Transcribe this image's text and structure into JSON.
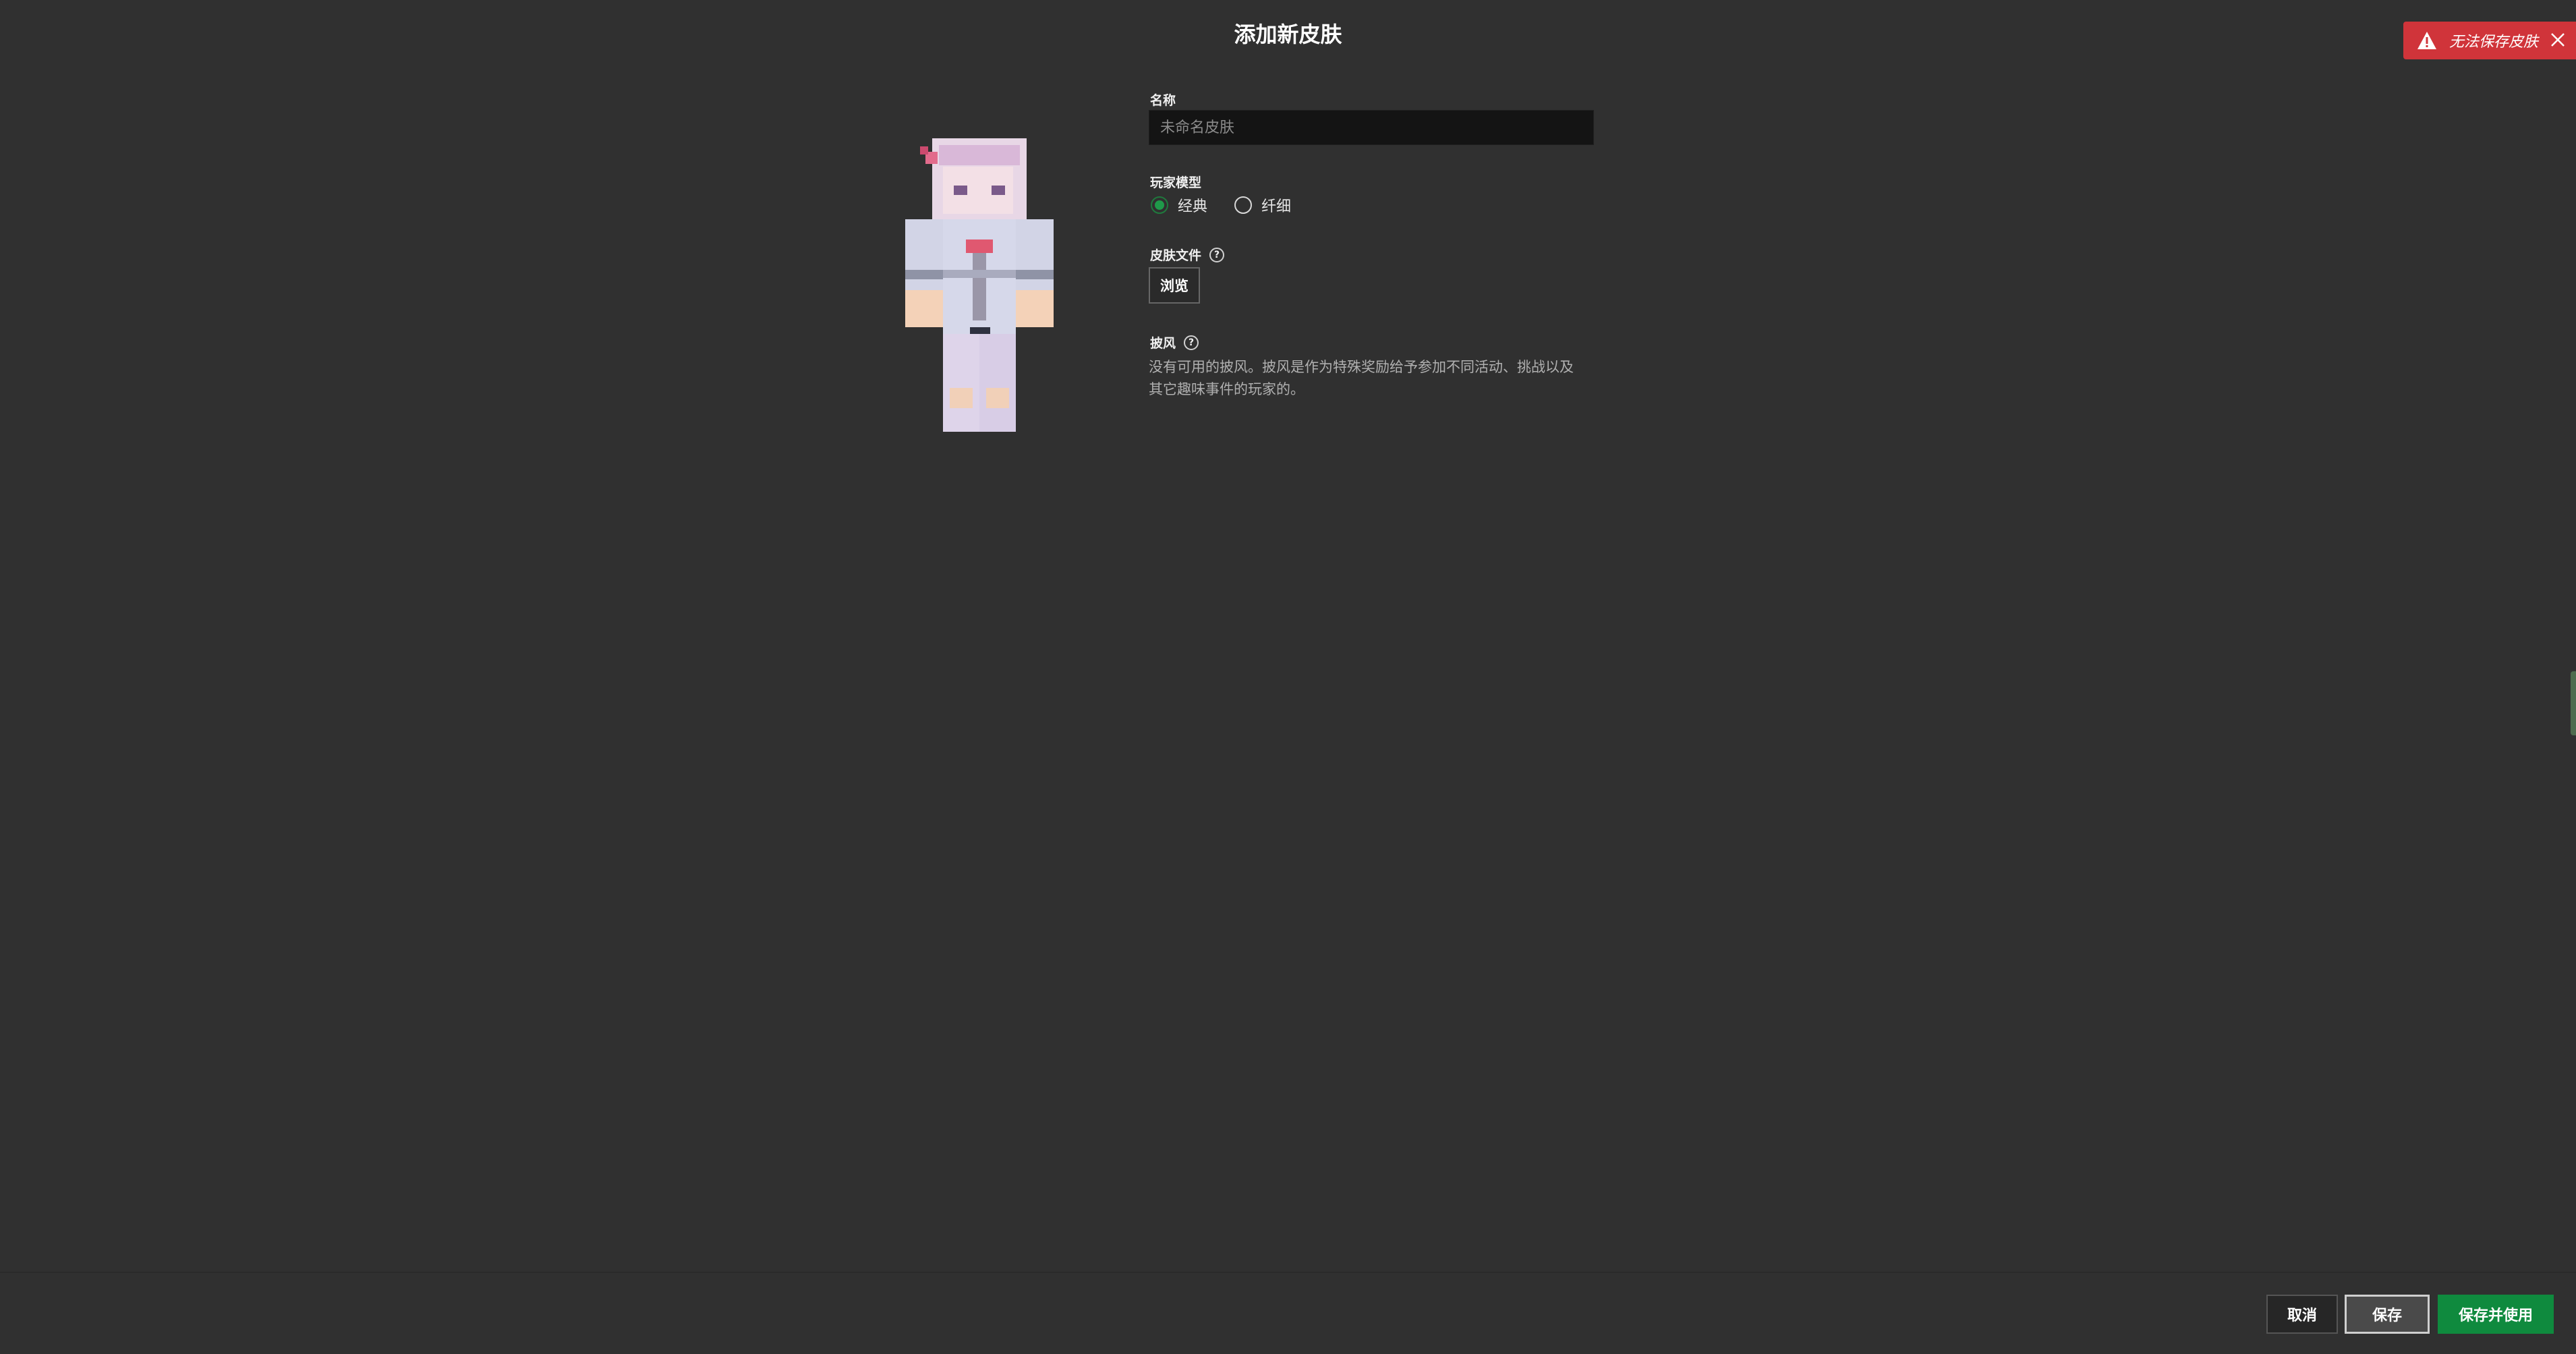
{
  "dialog": {
    "title": "添加新皮肤"
  },
  "toast": {
    "message": "无法保存皮肤",
    "color": "#d0343a"
  },
  "form": {
    "name_label": "名称",
    "name_placeholder": "未命名皮肤",
    "name_value": "",
    "model_label": "玩家模型",
    "model_options": [
      {
        "label": "经典",
        "selected": true
      },
      {
        "label": "纤细",
        "selected": false
      }
    ],
    "file_label": "皮肤文件",
    "browse_label": "浏览",
    "cape_label": "披风",
    "cape_description": "没有可用的披风。披风是作为特殊奖励给予参加不同活动、挑战以及其它趣味事件的玩家的。"
  },
  "footer": {
    "cancel_label": "取消",
    "save_label": "保存",
    "save_and_use_label": "保存并使用"
  },
  "colors": {
    "background": "#303030",
    "accent_green": "#0f8a3e",
    "error_red": "#d0343a"
  },
  "icons": [
    "warning-icon",
    "close-icon",
    "help-icon"
  ]
}
